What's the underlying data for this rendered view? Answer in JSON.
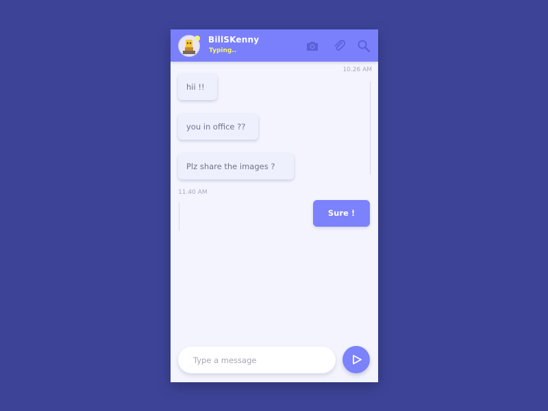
{
  "header": {
    "contact_name": "BillSKenny",
    "status": "Typing..",
    "icons": [
      "camera-icon",
      "paperclip-icon",
      "search-icon"
    ]
  },
  "messages": [
    {
      "direction": "incoming",
      "text": "hii !!"
    },
    {
      "direction": "incoming",
      "text": "you in office ??"
    },
    {
      "direction": "incoming",
      "text": "Plz share the images ?"
    },
    {
      "direction": "outgoing",
      "text": "Sure !"
    }
  ],
  "timestamps": [
    "10.26 AM",
    "11.40 AM"
  ],
  "composer": {
    "placeholder": "Type a message",
    "send_icon": "send-icon"
  },
  "colors": {
    "background": "#3d4498",
    "accent": "#7a80fc",
    "status": "#f9f36e",
    "chat_bg": "#f3f4fe"
  }
}
